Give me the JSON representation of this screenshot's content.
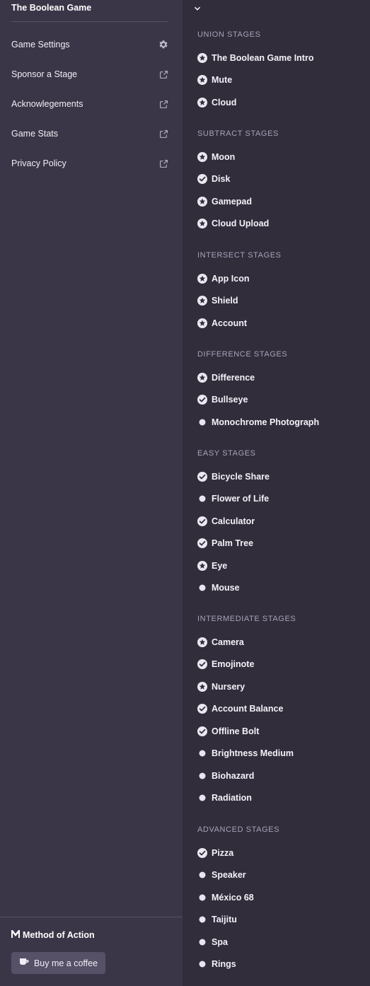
{
  "sidebar": {
    "title": "The Boolean Game",
    "items": [
      {
        "label": "Game Settings",
        "icon": "gear-icon"
      },
      {
        "label": "Sponsor a Stage",
        "icon": "external-link-icon"
      },
      {
        "label": "Acknowlegements",
        "icon": "external-link-icon"
      },
      {
        "label": "Game Stats",
        "icon": "external-link-icon"
      },
      {
        "label": "Privacy Policy",
        "icon": "external-link-icon"
      }
    ],
    "brand": "Method of Action",
    "coffee_label": "Buy me a coffee"
  },
  "sections": [
    {
      "title": "UNION STAGES",
      "stages": [
        {
          "label": "The Boolean Game Intro",
          "status": "star"
        },
        {
          "label": "Mute",
          "status": "star"
        },
        {
          "label": "Cloud",
          "status": "star"
        }
      ]
    },
    {
      "title": "SUBTRACT STAGES",
      "stages": [
        {
          "label": "Moon",
          "status": "star"
        },
        {
          "label": "Disk",
          "status": "check"
        },
        {
          "label": "Gamepad",
          "status": "star"
        },
        {
          "label": "Cloud Upload",
          "status": "star"
        }
      ]
    },
    {
      "title": "INTERSECT STAGES",
      "stages": [
        {
          "label": "App Icon",
          "status": "star"
        },
        {
          "label": "Shield",
          "status": "star"
        },
        {
          "label": "Account",
          "status": "star"
        }
      ]
    },
    {
      "title": "DIFFERENCE STAGES",
      "stages": [
        {
          "label": "Difference",
          "status": "star"
        },
        {
          "label": "Bullseye",
          "status": "check"
        },
        {
          "label": "Monochrome Photograph",
          "status": "dot"
        }
      ]
    },
    {
      "title": "EASY STAGES",
      "stages": [
        {
          "label": "Bicycle Share",
          "status": "check"
        },
        {
          "label": "Flower of Life",
          "status": "dot"
        },
        {
          "label": "Calculator",
          "status": "check"
        },
        {
          "label": "Palm Tree",
          "status": "check"
        },
        {
          "label": "Eye",
          "status": "star"
        },
        {
          "label": "Mouse",
          "status": "dot"
        }
      ]
    },
    {
      "title": "INTERMEDIATE STAGES",
      "stages": [
        {
          "label": "Camera",
          "status": "star"
        },
        {
          "label": "Emojinote",
          "status": "check"
        },
        {
          "label": "Nursery",
          "status": "star"
        },
        {
          "label": "Account Balance",
          "status": "check"
        },
        {
          "label": "Offline Bolt",
          "status": "check"
        },
        {
          "label": "Brightness Medium",
          "status": "dot"
        },
        {
          "label": "Biohazard",
          "status": "dot"
        },
        {
          "label": "Radiation",
          "status": "dot"
        }
      ]
    },
    {
      "title": "ADVANCED STAGES",
      "stages": [
        {
          "label": "Pizza",
          "status": "check"
        },
        {
          "label": "Speaker",
          "status": "dot"
        },
        {
          "label": "México 68",
          "status": "dot"
        },
        {
          "label": "Taijitu",
          "status": "dot"
        },
        {
          "label": "Spa",
          "status": "dot"
        },
        {
          "label": "Rings",
          "status": "dot"
        }
      ]
    }
  ]
}
